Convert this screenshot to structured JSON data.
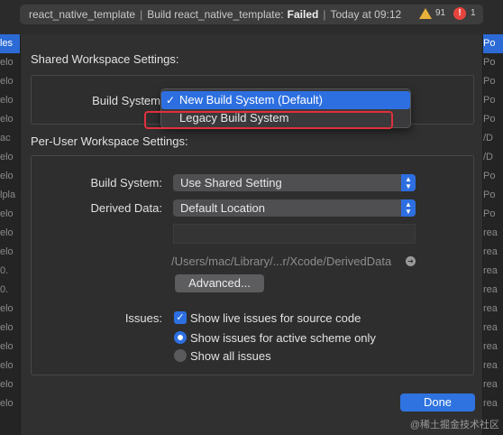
{
  "status": {
    "project": "react_native_template",
    "build_text": "Build react_native_template:",
    "result": "Failed",
    "time": "Today at 09:12",
    "warnings": "91",
    "errors": "1",
    "error_glyph": "!"
  },
  "background": {
    "left": [
      "les",
      "elo",
      "elo",
      "elo",
      "elo",
      "ac",
      "elo",
      "elo",
      "lpla",
      "elo",
      "elo",
      "elo",
      "0.",
      "0.",
      "elo",
      "elo",
      "elo",
      "elo",
      "elo",
      "elo"
    ],
    "right": [
      "Po",
      "Po",
      "Po",
      "Po",
      "Po",
      "/D",
      "/D",
      "Po",
      "Po",
      "Po",
      "rea",
      "rea",
      "rea",
      "rea",
      "rea",
      "rea",
      "rea",
      "rea",
      "rea",
      "rea"
    ]
  },
  "shared": {
    "title": "Shared Workspace Settings:",
    "build_system_label": "Build System",
    "menu": {
      "selected": "New Build System (Default)",
      "other": "Legacy Build System",
      "check_glyph": "✓"
    }
  },
  "per_user": {
    "title": "Per-User Workspace Settings:",
    "build_system_label": "Build System:",
    "build_system_value": "Use Shared Setting",
    "derived_data_label": "Derived Data:",
    "derived_data_value": "Default Location",
    "path": "/Users/mac/Library/...r/Xcode/DerivedData",
    "path_arrow_glyph": "➔",
    "advanced_button": "Advanced...",
    "issues_label": "Issues:",
    "show_live": "Show live issues for source code",
    "show_active": "Show issues for active scheme only",
    "show_all": "Show all issues",
    "check_glyph": "✓"
  },
  "done_button": "Done",
  "watermark": "@稀土掘金技术社区",
  "colors": {
    "accent": "#2d6fe0",
    "annotation": "#e0303c",
    "warning": "#e8b23a",
    "error": "#e5443d"
  }
}
